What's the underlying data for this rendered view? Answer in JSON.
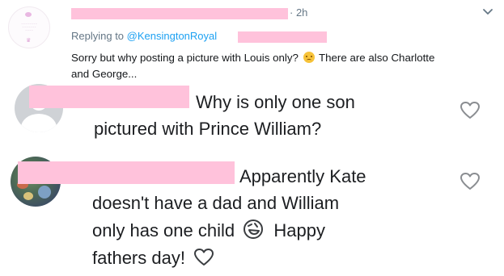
{
  "tweet": {
    "timestamp": "· 2h",
    "replying_prefix": "Replying to ",
    "replying_handle": "@KensingtonRoyal",
    "text_before_emoji": "Sorry but why posting a picture with Louis only? ",
    "emoji_icon": "worried-face-emoji",
    "text_after_emoji": " There are also Charlotte and George..."
  },
  "comments": [
    {
      "text_lines": [
        "Why is only one son",
        "pictured with Prince William?"
      ]
    },
    {
      "text_lines": [
        "Apparently Kate",
        "doesn't have a dad and William",
        "only has one child",
        "Happy",
        "fathers day!"
      ],
      "emoji_icon": "rolling-laughing-emoji"
    }
  ],
  "colors": {
    "redaction": "#ffc2db",
    "link": "#1da1f2",
    "muted": "#657786",
    "heart": "#8a8d91"
  }
}
